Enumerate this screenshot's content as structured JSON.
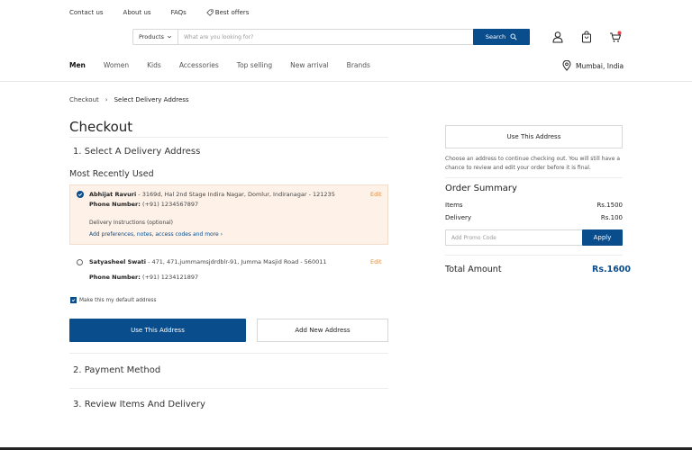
{
  "topbar": {
    "links": [
      "Contact us",
      "About us",
      "FAQs"
    ],
    "offers_label": "Best offers"
  },
  "search": {
    "category": "Products",
    "placeholder": "What are you looking for?",
    "button_label": "Search"
  },
  "catnav": [
    "Men",
    "Women",
    "Kids",
    "Accessories",
    "Top selling",
    "New arrival",
    "Brands"
  ],
  "location": "Mumbai, India",
  "breadcrumb": {
    "parent": "Checkout",
    "separator": "›",
    "current": "Select Delivery Address"
  },
  "page_title": "Checkout",
  "steps": {
    "step1": "1. Select A Delivery Address",
    "step2": "2. Payment Method",
    "step3": "3. Review Items And Delivery"
  },
  "most_recently_used": "Most Recently Used",
  "addresses": [
    {
      "name": "Abhijat Ravuri",
      "address": " - 3169d, Hal 2nd Stage Indira Nagar, Domlur, Indiranagar  - 121235",
      "phone_label": "Phone Number:",
      "phone": " (+91) 1234567897",
      "instructions_label": "Delivery Instructions (optional)",
      "instructions_link": "Add preferences, notes, access codes and more",
      "edit": "Edit",
      "selected": true
    },
    {
      "name": "Satyasheel Swati",
      "address": " - 471, 471,jummamsjdrdblr-91, Jumma Masjid Road  -  560011",
      "phone_label": "Phone Number:",
      "phone": " (+91) 1234121897",
      "edit": "Edit",
      "selected": false
    }
  ],
  "default_checkbox_label": "Make this my default address",
  "buttons": {
    "use_address": "Use This Address",
    "add_address": "Add New Address"
  },
  "sidebar": {
    "use_address": "Use This Address",
    "help_text": "Choose an address to continue checking out. You will still have a chance to review and edit your order before it is final.",
    "summary_title": "Order Summary",
    "items_label": "Items",
    "items_value": "Rs.1500",
    "delivery_label": "Delivery",
    "delivery_value": "Rs.100",
    "promo_placeholder": "Add Promo Code",
    "apply_label": "Apply",
    "total_label": "Total Amount",
    "total_value": "Rs.1600"
  },
  "colors": {
    "primary": "#0a4d8c",
    "accent": "#e08a3c",
    "selected_bg": "#fdf1e8"
  }
}
